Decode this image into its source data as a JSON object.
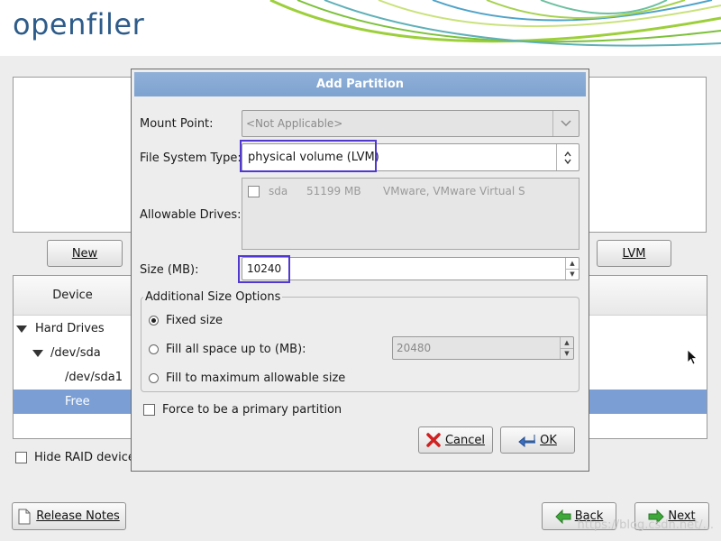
{
  "header": {
    "logo_text": "openfiler"
  },
  "main": {
    "new_button": "New",
    "lvm_button": "LVM",
    "tree_header": "Device",
    "tree": {
      "hard_drives": "Hard Drives",
      "dev_sda": "/dev/sda",
      "dev_sda1": "/dev/sda1",
      "free": "Free"
    },
    "hide_raid": "Hide RAID device/",
    "selection_color": "#7b9fd4"
  },
  "footer": {
    "release_notes": "Release Notes",
    "back": "Back",
    "next": "Next",
    "watermark": "https://blog.csdn.net/..."
  },
  "dialog": {
    "title": "Add Partition",
    "mount_point_label": "Mount Point:",
    "mount_point_value": "<Not Applicable>",
    "fs_type_label": "File System Type:",
    "fs_type_value": "physical volume (LVM)",
    "allowable_drives_label": "Allowable Drives:",
    "drive": {
      "name": "sda",
      "size": "51199 MB",
      "model": "VMware, VMware Virtual S"
    },
    "size_label": "Size (MB):",
    "size_value": "10240",
    "options_legend": "Additional Size Options",
    "opt_fixed": "Fixed size",
    "opt_fill_up_to": "Fill all space up to (MB):",
    "opt_fill_up_to_value": "20480",
    "opt_fill_max": "Fill to maximum allowable size",
    "force_primary": "Force to be a primary partition",
    "cancel": "Cancel",
    "ok": "OK"
  }
}
